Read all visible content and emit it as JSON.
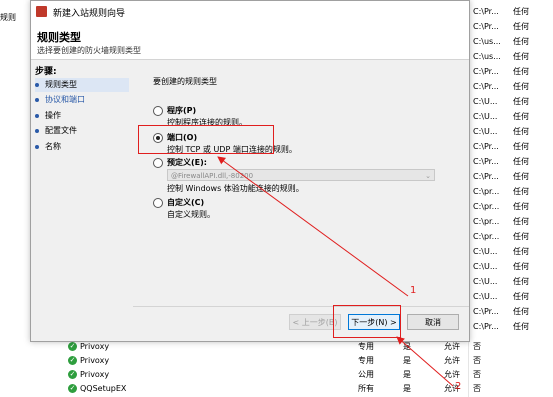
{
  "background": {
    "left_text": "规则",
    "right_rows": [
      {
        "path": "C:\\Pr...",
        "action": "任何"
      },
      {
        "path": "C:\\Pr...",
        "action": "任何"
      },
      {
        "path": "C:\\us...",
        "action": "任何"
      },
      {
        "path": "C:\\us...",
        "action": "任何"
      },
      {
        "path": "C:\\Pr...",
        "action": "任何"
      },
      {
        "path": "C:\\Pr...",
        "action": "任何"
      },
      {
        "path": "C:\\U...",
        "action": "任何"
      },
      {
        "path": "C:\\U...",
        "action": "任何"
      },
      {
        "path": "C:\\U...",
        "action": "任何"
      },
      {
        "path": "C:\\Pr...",
        "action": "任何"
      },
      {
        "path": "C:\\Pr...",
        "action": "任何"
      },
      {
        "path": "C:\\Pr...",
        "action": "任何"
      },
      {
        "path": "C:\\pr...",
        "action": "任何"
      },
      {
        "path": "C:\\pr...",
        "action": "任何"
      },
      {
        "path": "C:\\pr...",
        "action": "任何"
      },
      {
        "path": "C:\\pr...",
        "action": "任何"
      },
      {
        "path": "C:\\U...",
        "action": "任何"
      },
      {
        "path": "C:\\U...",
        "action": "任何"
      },
      {
        "path": "C:\\U...",
        "action": "任何"
      },
      {
        "path": "C:\\U...",
        "action": "任何"
      },
      {
        "path": "C:\\Pr...",
        "action": "任何"
      },
      {
        "path": "C:\\Pr...",
        "action": "任何"
      }
    ],
    "bottom_rows": [
      {
        "name": "Privoxy",
        "profile": "专用",
        "enabled": "是",
        "action": "允许",
        "override": "否",
        "path": "E:\\sh...",
        "extra": "任何"
      },
      {
        "name": "Privoxy",
        "profile": "专用",
        "enabled": "是",
        "action": "允许",
        "override": "否",
        "path": "E:\\sh...",
        "extra": "任何"
      },
      {
        "name": "Privoxy",
        "profile": "公用",
        "enabled": "是",
        "action": "允许",
        "override": "否",
        "path": "E:\\sh...",
        "extra": "任何"
      },
      {
        "name": "QQSetupEX",
        "profile": "所有",
        "enabled": "是",
        "action": "允许",
        "override": "否",
        "path": "E:\\U...",
        "extra": "任何"
      }
    ]
  },
  "dialog": {
    "title": "新建入站规则向导",
    "heading": "规则类型",
    "subheading": "选择要创建的防火墙规则类型",
    "steps_label": "步骤:",
    "steps": [
      {
        "label": "规则类型",
        "state": "active"
      },
      {
        "label": "协议和端口",
        "state": "link"
      },
      {
        "label": "操作",
        "state": "normal"
      },
      {
        "label": "配置文件",
        "state": "normal"
      },
      {
        "label": "名称",
        "state": "normal"
      }
    ],
    "question": "要创建的规则类型",
    "options": {
      "program": {
        "label": "程序(P)",
        "desc": "控制程序连接的规则。",
        "selected": false
      },
      "port": {
        "label": "端口(O)",
        "desc": "控制 TCP 或 UDP 端口连接的规则。",
        "selected": true
      },
      "predefined": {
        "label": "预定义(E):",
        "combo": "@FirewallAPI.dll,-80200",
        "desc": "控制 Windows 体验功能连接的规则。",
        "selected": false
      },
      "custom": {
        "label": "自定义(C)",
        "desc": "自定义规则。",
        "selected": false
      }
    },
    "buttons": {
      "back": "< 上一步(B)",
      "next": "下一步(N) >",
      "cancel": "取消"
    }
  },
  "annotations": {
    "label1": "1",
    "label2": "2",
    "color": "#e01e1e"
  }
}
